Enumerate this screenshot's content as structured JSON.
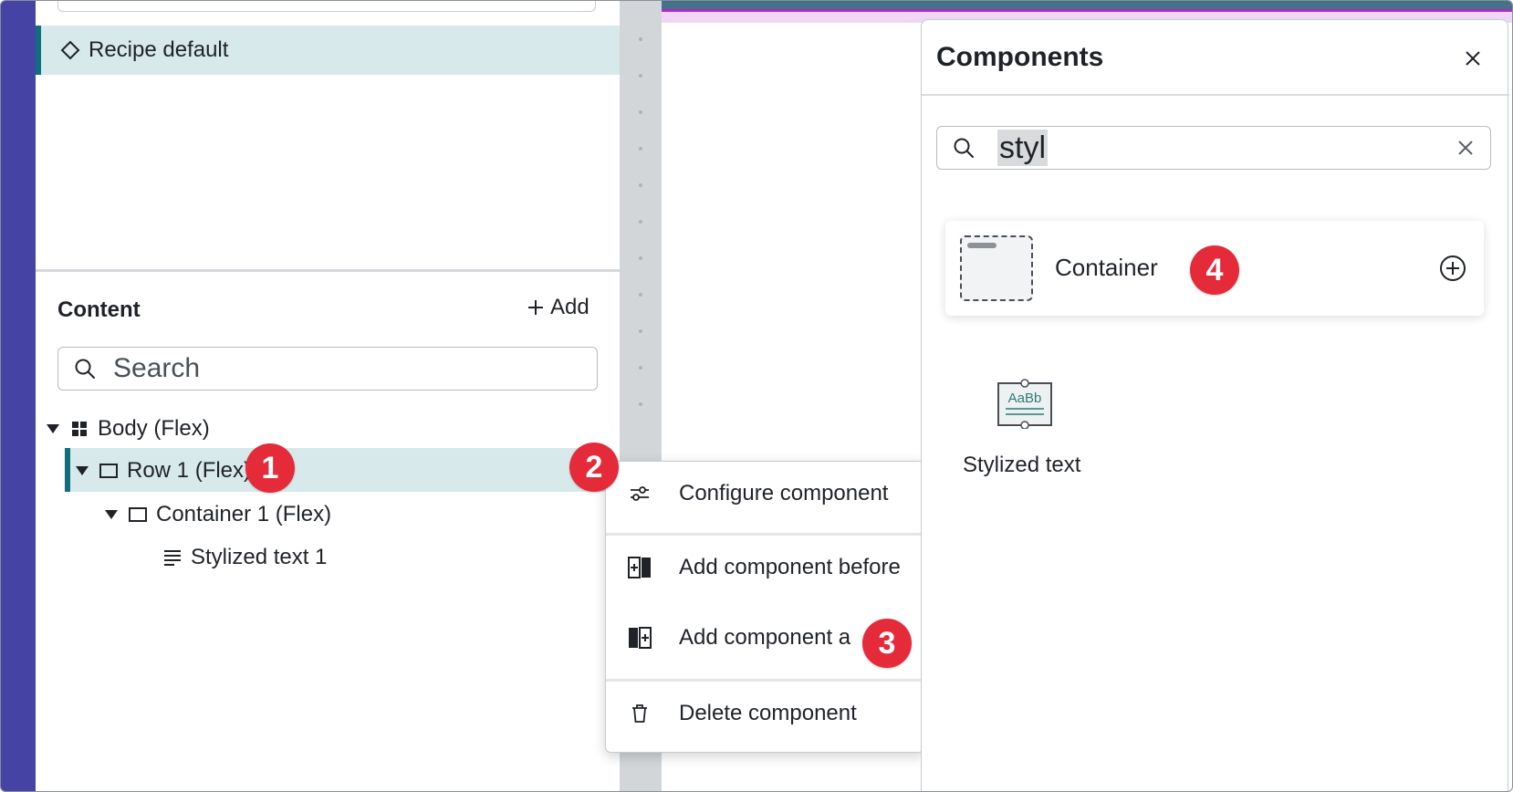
{
  "left_panel": {
    "recipe_label": "Recipe default",
    "content_title": "Content",
    "add_label": "Add",
    "search_placeholder": "Search",
    "tree": [
      {
        "label": "Body (Flex)",
        "icon": "dashboard-icon"
      },
      {
        "label": "Row 1 (Flex)",
        "icon": "rectangle-icon"
      },
      {
        "label": "Container 1 (Flex)",
        "icon": "rectangle-icon"
      },
      {
        "label": "Stylized text 1",
        "icon": "text-lines-icon"
      }
    ]
  },
  "context_menu": {
    "items": [
      {
        "label": "Configure component",
        "icon": "sliders-icon"
      },
      {
        "label": "Add component before",
        "icon": "add-before-icon"
      },
      {
        "label": "Add component a",
        "icon": "add-after-icon"
      },
      {
        "label": "Delete component",
        "icon": "trash-icon"
      }
    ]
  },
  "components_panel": {
    "title": "Components",
    "search_value": "styl",
    "items": [
      {
        "name": "Container"
      },
      {
        "name": "Stylized text",
        "thumb_text": "AaBb"
      }
    ]
  },
  "badges": [
    "1",
    "2",
    "3",
    "4"
  ],
  "colors": {
    "sidebar_purple": "#4544a4",
    "selection_bg": "#d7e9ea",
    "selection_accent": "#0f6f7f",
    "badge_red": "#e52a3a"
  }
}
